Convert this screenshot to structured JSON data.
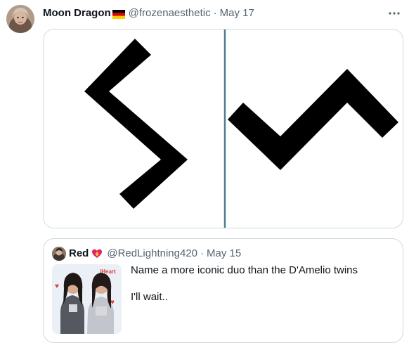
{
  "author": {
    "display_name": "Moon Dragon",
    "handle": "@frozenaesthetic",
    "separator": "·",
    "date": "May 17",
    "flag_icon": "germany-flag-icon",
    "avatar_icon": "profile-avatar"
  },
  "menu": {
    "more_icon": "more-horizontal-icon"
  },
  "media": {
    "description_icon": "abstract-symbol-image",
    "panels": 2
  },
  "quote": {
    "display_name": "Red",
    "emoji_icon": "heart-fire-icon",
    "handle": "@RedLightning420",
    "separator": "·",
    "date": "May 15",
    "text_line_1": "Name a more iconic duo than the D'Amelio twins",
    "text_line_2": "I'll wait..",
    "thumbnail_icon": "photo-thumbnail"
  },
  "colors": {
    "text_primary": "#0f1419",
    "text_secondary": "#536471",
    "border": "#cfd9de",
    "media_divider": "#4f7d8f"
  }
}
